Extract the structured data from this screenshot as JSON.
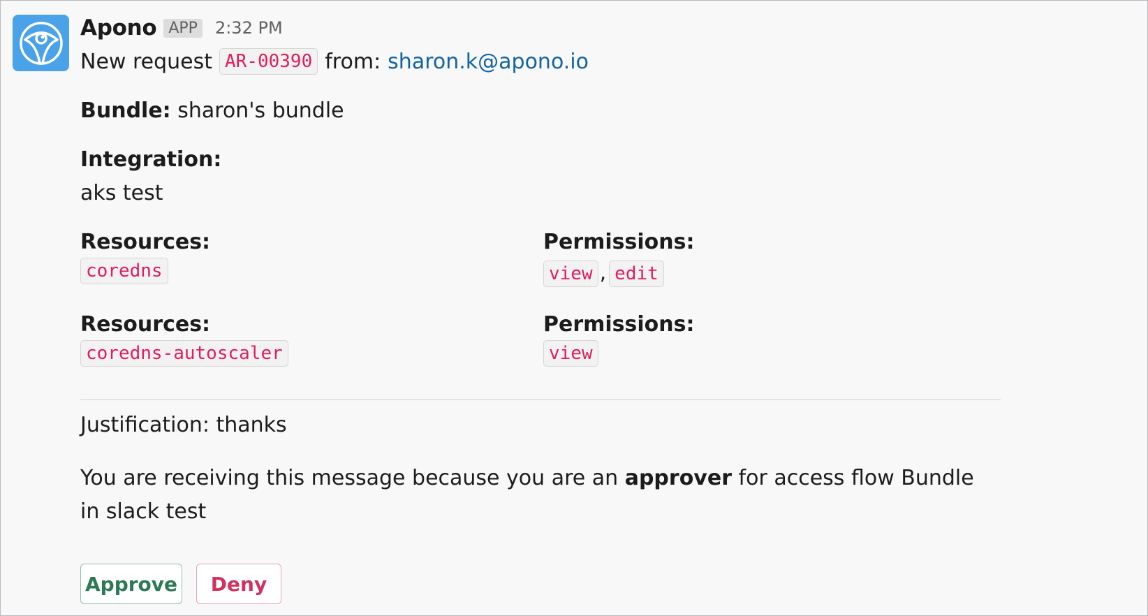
{
  "message": {
    "app_name": "Apono",
    "app_badge": "APP",
    "time": "2:32 PM",
    "avatar_icon": "apono-eye-logo-icon",
    "request_prefix": "New request",
    "request_id": "AR-00390",
    "from_label": "from:",
    "from_email": "sharon.k@apono.io",
    "bundle_label": "Bundle:",
    "bundle_value": "sharon's bundle",
    "integration_label": "Integration:",
    "integration_value": "aks test",
    "access_rows": [
      {
        "resources_label": "Resources:",
        "resources": [
          "coredns"
        ],
        "permissions_label": "Permissions:",
        "permissions": [
          "view",
          "edit"
        ]
      },
      {
        "resources_label": "Resources:",
        "resources": [
          "coredns-autoscaler"
        ],
        "permissions_label": "Permissions:",
        "permissions": [
          "view"
        ]
      }
    ],
    "justification": "Justification: thanks",
    "notice_prefix": "You are receiving this message because you are an",
    "notice_bold": "approver",
    "notice_suffix": "for access flow Bundle in slack test",
    "approve_label": "Approve",
    "deny_label": "Deny"
  },
  "colors": {
    "avatar_bg": "#4aa2e8",
    "code_text": "#e01e5a",
    "link": "#1264a3",
    "approve": "#2c7a54",
    "deny": "#d0325e"
  }
}
